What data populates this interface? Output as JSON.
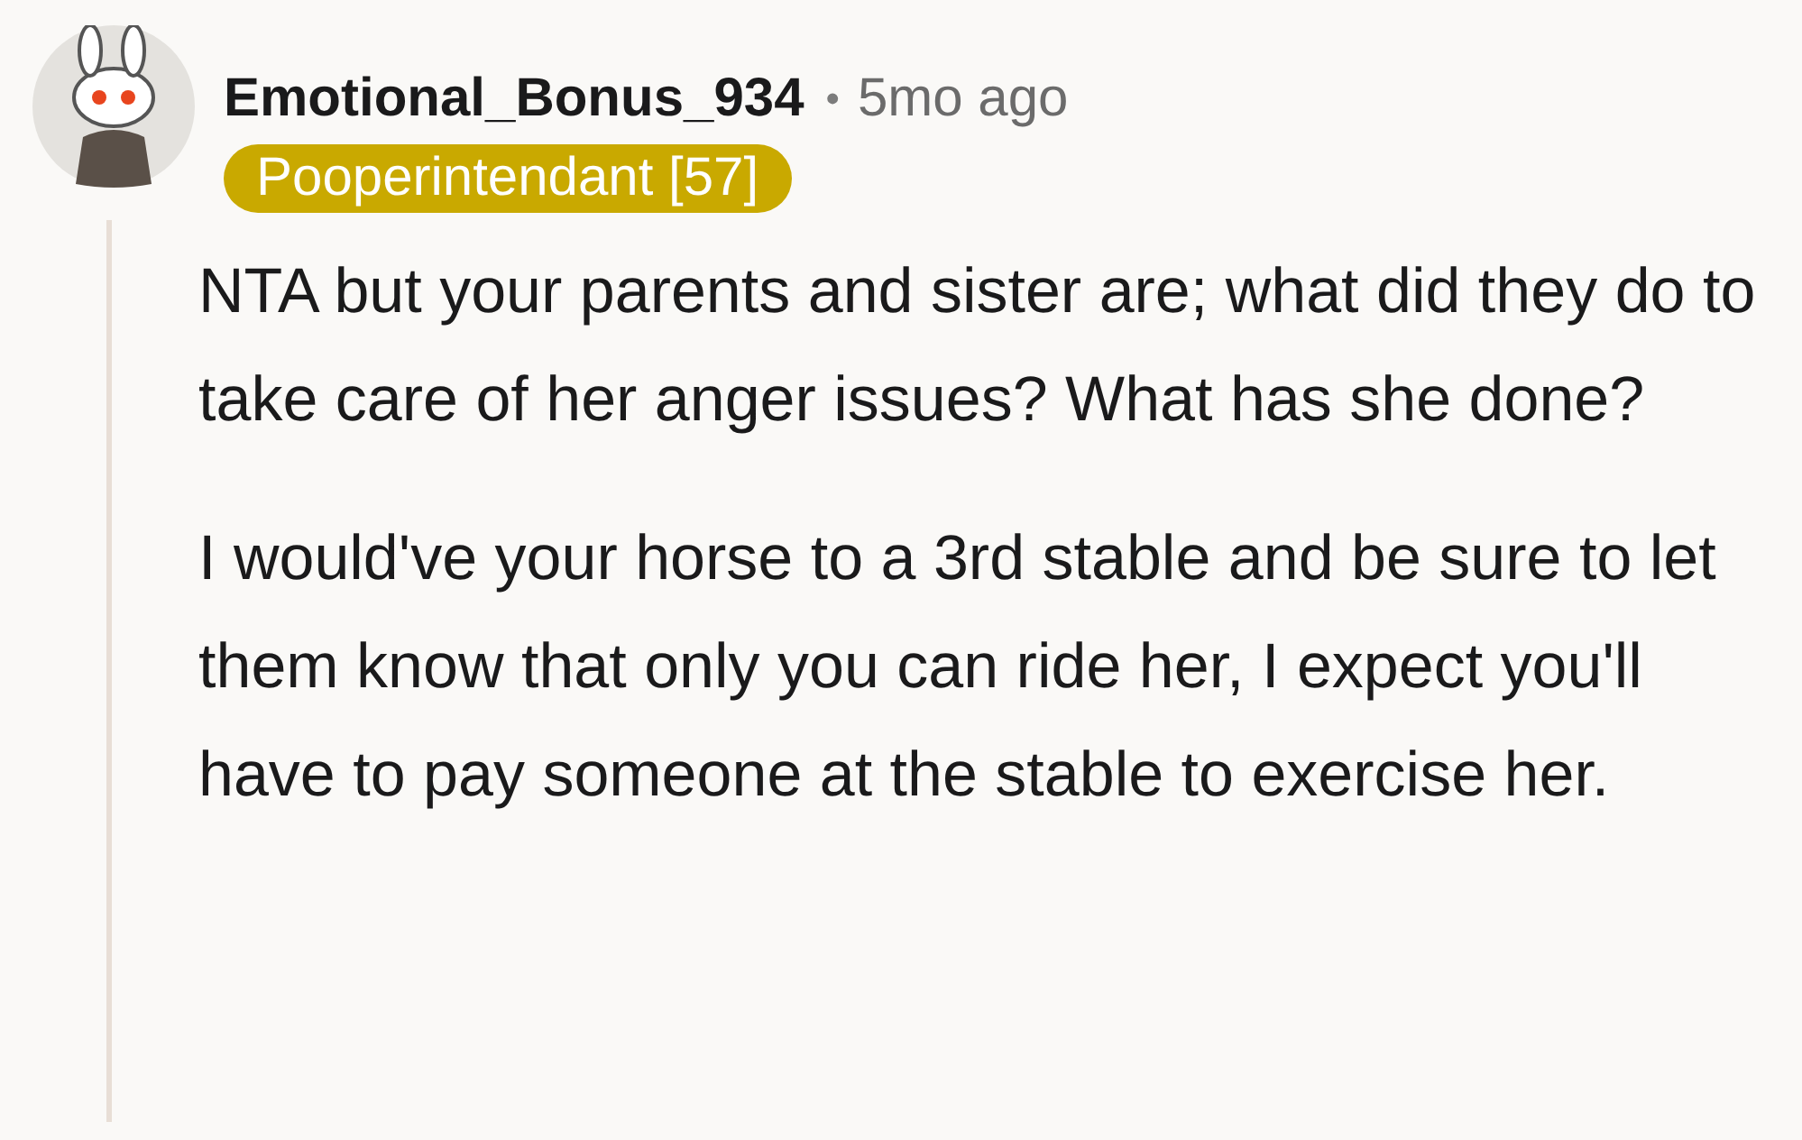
{
  "comment": {
    "author": "Emotional_Bonus_934",
    "separator": "•",
    "time": "5mo ago",
    "flair": "Pooperintendant [57]",
    "paragraphs": [
      "NTA but your parents and sister are; what did they do to take care of her anger issues? What has she done?",
      "I would've your horse to a 3rd stable and be sure to let them know that only you can ride her, I expect you'll have to pay someone at the stable to exercise her."
    ]
  }
}
